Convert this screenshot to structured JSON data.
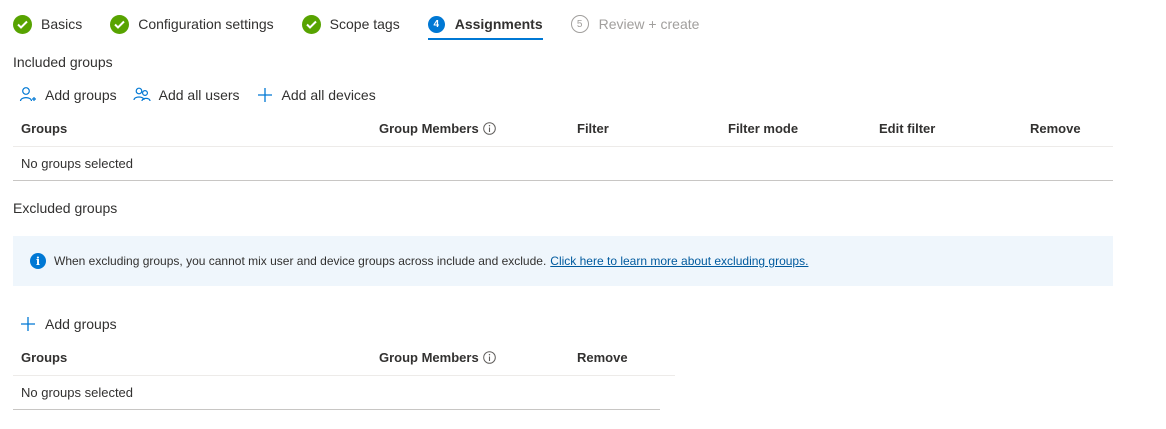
{
  "wizard": {
    "steps": [
      {
        "label": "Basics",
        "state": "done"
      },
      {
        "label": "Configuration settings",
        "state": "done"
      },
      {
        "label": "Scope tags",
        "state": "done"
      },
      {
        "label": "Assignments",
        "state": "active",
        "number": "4"
      },
      {
        "label": "Review + create",
        "state": "disabled",
        "number": "5"
      }
    ]
  },
  "included": {
    "title": "Included groups",
    "actions": {
      "add_groups": "Add groups",
      "add_all_users": "Add all users",
      "add_all_devices": "Add all devices"
    },
    "columns": [
      "Groups",
      "Group Members",
      "Filter",
      "Filter mode",
      "Edit filter",
      "Remove"
    ],
    "empty": "No groups selected"
  },
  "excluded": {
    "title": "Excluded groups",
    "notice_text": "When excluding groups, you cannot mix user and device groups across include and exclude.",
    "notice_link": "Click here to learn more about excluding groups.",
    "actions": {
      "add_groups": "Add groups"
    },
    "columns": [
      "Groups",
      "Group Members",
      "Remove"
    ],
    "empty": "No groups selected"
  },
  "colors": {
    "accent": "#0078d4",
    "success": "#57a300",
    "notice_bg": "#eff6fc"
  }
}
